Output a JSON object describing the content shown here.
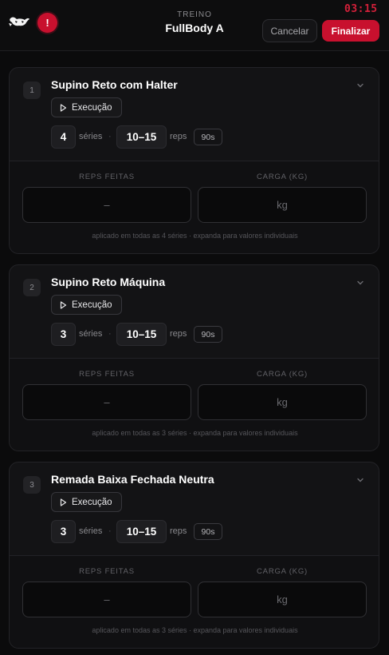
{
  "header": {
    "subtitle": "TREINO",
    "title": "FullBody A",
    "timer": "03:15",
    "alert_label": "!",
    "cancel_label": "Cancelar",
    "finish_label": "Finalizar",
    "logo_icon": "bull-logo-icon",
    "accent_color": "#c8102e"
  },
  "exercises": [
    {
      "number": "1",
      "name": "Supino Reto com Halter",
      "exec_label": "Execução",
      "sets": "4",
      "sets_label": "séries",
      "separator": "·",
      "reps": "10–15",
      "reps_label": "reps",
      "rest": "90s",
      "reps_done_label": "REPS FEITAS",
      "load_label": "CARGA (KG)",
      "reps_placeholder": "–",
      "load_placeholder": "kg",
      "hint": "aplicado em todas as 4 séries · expanda para valores individuais"
    },
    {
      "number": "2",
      "name": "Supino Reto Máquina",
      "exec_label": "Execução",
      "sets": "3",
      "sets_label": "séries",
      "separator": "·",
      "reps": "10–15",
      "reps_label": "reps",
      "rest": "90s",
      "reps_done_label": "REPS FEITAS",
      "load_label": "CARGA (KG)",
      "reps_placeholder": "–",
      "load_placeholder": "kg",
      "hint": "aplicado em todas as 3 séries · expanda para valores individuais"
    },
    {
      "number": "3",
      "name": "Remada Baixa Fechada Neutra",
      "exec_label": "Execução",
      "sets": "3",
      "sets_label": "séries",
      "separator": "·",
      "reps": "10–15",
      "reps_label": "reps",
      "rest": "90s",
      "reps_done_label": "REPS FEITAS",
      "load_label": "CARGA (KG)",
      "reps_placeholder": "–",
      "load_placeholder": "kg",
      "hint": "aplicado em todas as 3 séries · expanda para valores individuais"
    }
  ]
}
